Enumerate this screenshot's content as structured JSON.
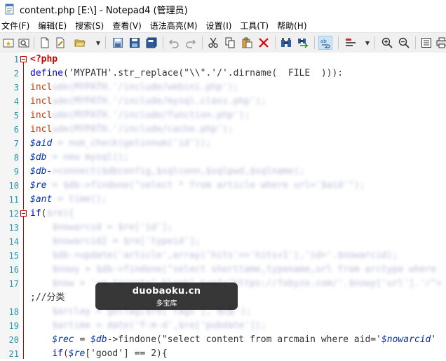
{
  "window": {
    "title": "content.php [E:\\] - Notepad4 (管理员)"
  },
  "menu": [
    "文件(F)",
    "编辑(E)",
    "搜索(S)",
    "查看(V)",
    "语法高亮(M)",
    "设置(I)",
    "工具(T)",
    "帮助(H)"
  ],
  "editor": {
    "lines": [
      {
        "n": "1",
        "segs": [
          [
            "php",
            "<?php"
          ]
        ]
      },
      {
        "n": "2",
        "segs": [
          [
            "kw",
            "define"
          ],
          [
            "plain",
            "('MYPATH'.str_replace(\"\\\\\".'/'.dirname(  FILE  ))):"
          ]
        ]
      },
      {
        "n": "3",
        "segs": [
          [
            "inc",
            "incl"
          ],
          [
            "blur",
            "ude(MYPATH.'/include/webini.php');"
          ]
        ]
      },
      {
        "n": "4",
        "segs": [
          [
            "inc",
            "incl"
          ],
          [
            "blur",
            "ude(MYPATH.'/include/mysql.class.php');"
          ]
        ]
      },
      {
        "n": "5",
        "segs": [
          [
            "inc",
            "incl"
          ],
          [
            "blur",
            "ude(MYPATH.'/include/function.php');"
          ]
        ]
      },
      {
        "n": "6",
        "segs": [
          [
            "inc",
            "incl"
          ],
          [
            "blur",
            "ude(MYPATH.'/include/cache.php');"
          ]
        ]
      },
      {
        "n": "7",
        "segs": [
          [
            "var",
            "$aid"
          ],
          [
            "blur",
            " = num_check(getinnum('id'));"
          ]
        ]
      },
      {
        "n": "8",
        "segs": [
          [
            "var",
            "$db"
          ],
          [
            "blur",
            " = new mysql();"
          ]
        ]
      },
      {
        "n": "9",
        "segs": [
          [
            "var",
            "$db-"
          ],
          [
            "blur",
            ">connect($dbconfig,$sqlconn,$sqlpwd,$sqlname);"
          ]
        ]
      },
      {
        "n": "10",
        "segs": [
          [
            "var",
            "$re"
          ],
          [
            "blur",
            " = $db->findone(\"select * from article where url='$aid'\");"
          ]
        ]
      },
      {
        "n": "11",
        "segs": [
          [
            "var",
            "$ant"
          ],
          [
            "blur",
            " = time();"
          ]
        ]
      },
      {
        "n": "12",
        "segs": [
          [
            "kw",
            "if"
          ],
          [
            "plain",
            "("
          ],
          [
            "blur",
            "$re){"
          ]
        ]
      },
      {
        "n": "13",
        "segs": [
          [
            "plain",
            "    "
          ],
          [
            "blur",
            "$nowarcid = $re['id'];"
          ]
        ]
      },
      {
        "n": "14",
        "segs": [
          [
            "plain",
            "    "
          ],
          [
            "blur",
            "$nowarcid2 = $re['typeid'];"
          ]
        ]
      },
      {
        "n": "15",
        "segs": [
          [
            "plain",
            "    "
          ],
          [
            "blur",
            "$db->update('article',array('hits'=>'hits+1'),'id='.$nowarcid);"
          ]
        ]
      },
      {
        "n": "16",
        "segs": [
          [
            "plain",
            "    "
          ],
          [
            "blur",
            "$nowy = $db->findone(\"select shorttame,typename,url from arctype where"
          ]
        ]
      },
      {
        "n": "17",
        "segs": [
          [
            "plain",
            "    "
          ],
          [
            "blur",
            "$now = '<a target=\"_blank\" href=\"https://fobyze.com/'.$nowy['url'].'/\">"
          ]
        ]
      },
      {
        "n": "",
        "segs": [
          [
            "plain",
            ";//分类"
          ]
        ]
      },
      {
        "n": "18",
        "segs": [
          [
            "plain",
            "    "
          ],
          [
            "blur",
            "$arclay = getTag($re['tags'],'标签');"
          ]
        ]
      },
      {
        "n": "19",
        "segs": [
          [
            "plain",
            "    "
          ],
          [
            "blur",
            "$artime = date('Y-m-d',$re['pubdate']);"
          ]
        ]
      },
      {
        "n": "20",
        "segs": [
          [
            "plain",
            "    "
          ],
          [
            "var",
            "$rec"
          ],
          [
            "plain",
            " = "
          ],
          [
            "var",
            "$db"
          ],
          [
            "plain",
            "->findone(\"select content from arcmain where aid='"
          ],
          [
            "var",
            "$nowarcid"
          ],
          [
            "plain",
            "'"
          ]
        ]
      },
      {
        "n": "21",
        "segs": [
          [
            "plain",
            "    "
          ],
          [
            "kw",
            "if"
          ],
          [
            "plain",
            "("
          ],
          [
            "var",
            "$re"
          ],
          [
            "plain",
            "['good'] == 2){"
          ]
        ]
      }
    ]
  },
  "watermark": {
    "line1": "duobaoku.cn",
    "line2": "多宝库"
  }
}
